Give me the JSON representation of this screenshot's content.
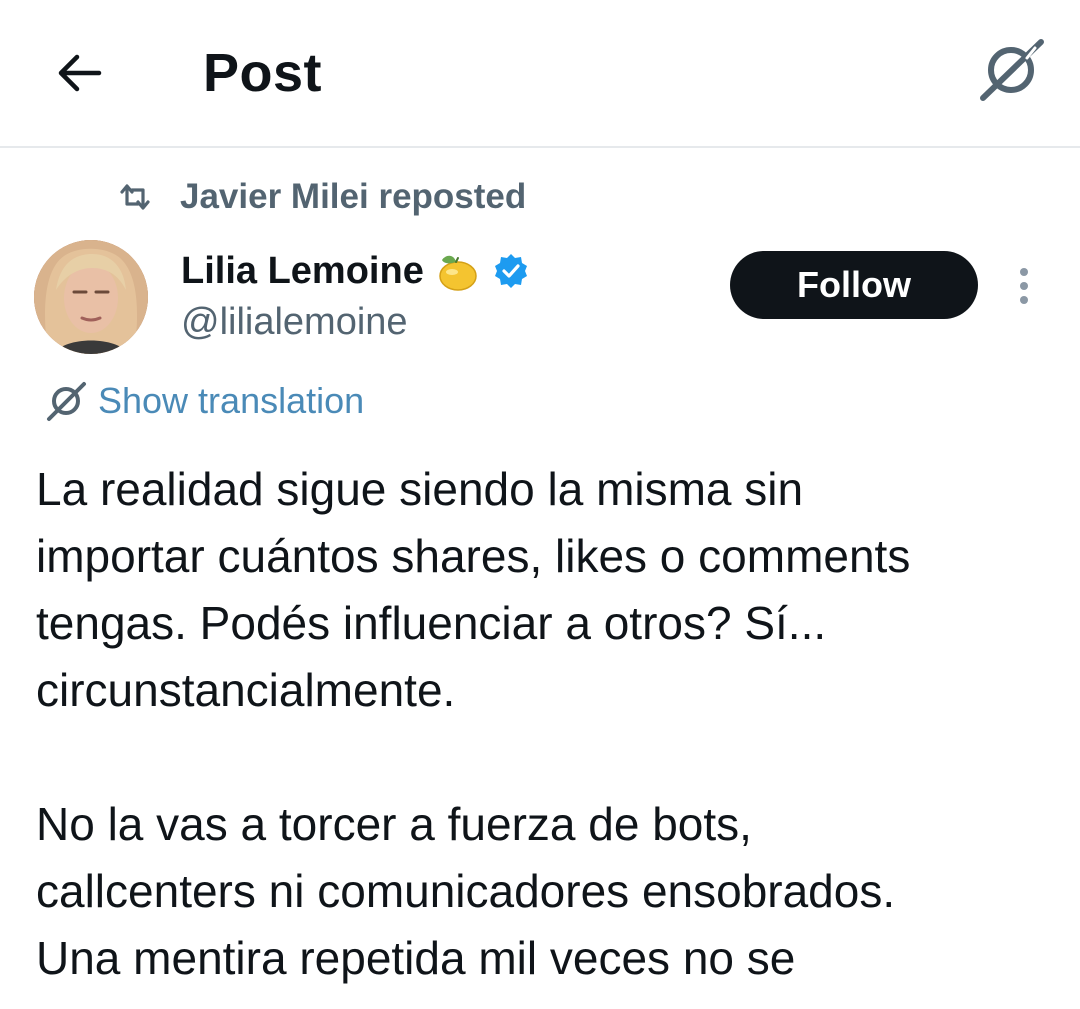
{
  "header": {
    "title": "Post",
    "back_icon": "arrow-left-icon",
    "grok_icon": "grok-slash-icon"
  },
  "repost": {
    "text": "Javier Milei reposted",
    "icon": "repost-icon"
  },
  "author": {
    "name": "Lilia Lemoine",
    "emoji": "🍋",
    "handle": "@lilialemoine",
    "verified": true,
    "verified_color": "#1d9bf0"
  },
  "follow_button": {
    "label": "Follow"
  },
  "translation": {
    "label": "Show translation",
    "color": "#4a8ab7"
  },
  "post": {
    "paragraph_1": [
      "La realidad sigue siendo la misma sin",
      "importar cuántos shares, likes o comments",
      "tengas. Podés influenciar a otros? Sí...",
      "circunstancialmente."
    ],
    "paragraph_2": [
      "No la vas a torcer a fuerza de bots,",
      "callcenters ni comunicadores ensobrados.",
      "Una mentira repetida mil veces no se"
    ]
  },
  "colors": {
    "text": "#0f1419",
    "secondary": "#536471",
    "follow_bg": "#0f1419",
    "divider": "#e6e9ec"
  }
}
